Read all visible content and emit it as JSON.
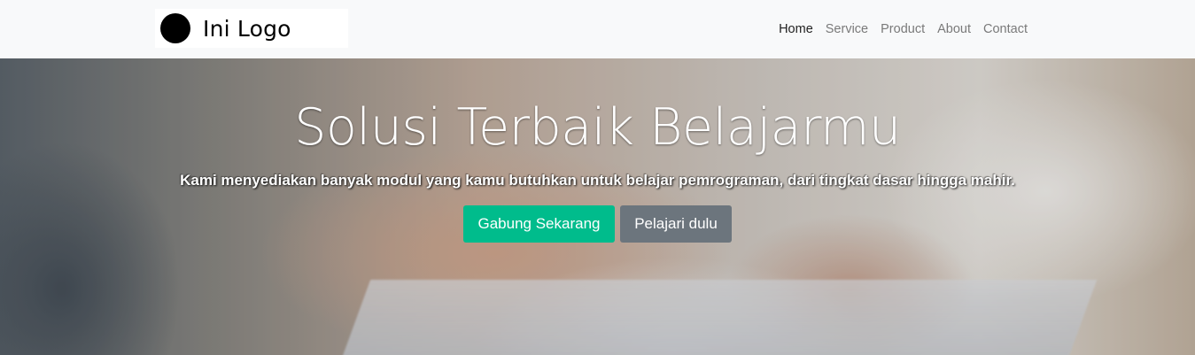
{
  "navbar": {
    "logo_text": "Ini Logo",
    "items": [
      {
        "label": "Home",
        "active": true
      },
      {
        "label": "Service",
        "active": false
      },
      {
        "label": "Product",
        "active": false
      },
      {
        "label": "About",
        "active": false
      },
      {
        "label": "Contact",
        "active": false
      }
    ]
  },
  "hero": {
    "title": "Solusi Terbaik Belajarmu",
    "subtitle": "Kami menyediakan banyak modul yang kamu butuhkan untuk belajar pemrograman, dari tingkat dasar hingga mahir.",
    "primary_button": "Gabung Sekarang",
    "secondary_button": "Pelajari dulu",
    "primary_color": "#00bc8c",
    "secondary_color": "#6c757d"
  }
}
